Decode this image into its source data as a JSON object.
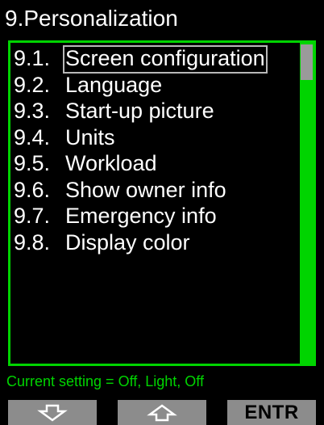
{
  "header": {
    "title": "9.Personalization"
  },
  "menu": {
    "selected_index": 0,
    "items": [
      {
        "number": "9.1.",
        "label": "Screen configuration"
      },
      {
        "number": "9.2.",
        "label": "Language"
      },
      {
        "number": "9.3.",
        "label": "Start-up picture"
      },
      {
        "number": "9.4.",
        "label": "Units"
      },
      {
        "number": "9.5.",
        "label": "Workload"
      },
      {
        "number": "9.6.",
        "label": "Show owner info"
      },
      {
        "number": "9.7.",
        "label": "Emergency info"
      },
      {
        "number": "9.8.",
        "label": "Display color"
      }
    ]
  },
  "status": {
    "text": "Current setting = Off, Light, Off"
  },
  "softkeys": {
    "left_icon": "down-arrow-icon",
    "middle_icon": "up-arrow-icon",
    "right_label": "ENTR"
  },
  "colors": {
    "accent": "#00d400",
    "softkey_bg": "#8c8c8c",
    "background": "#000000"
  }
}
